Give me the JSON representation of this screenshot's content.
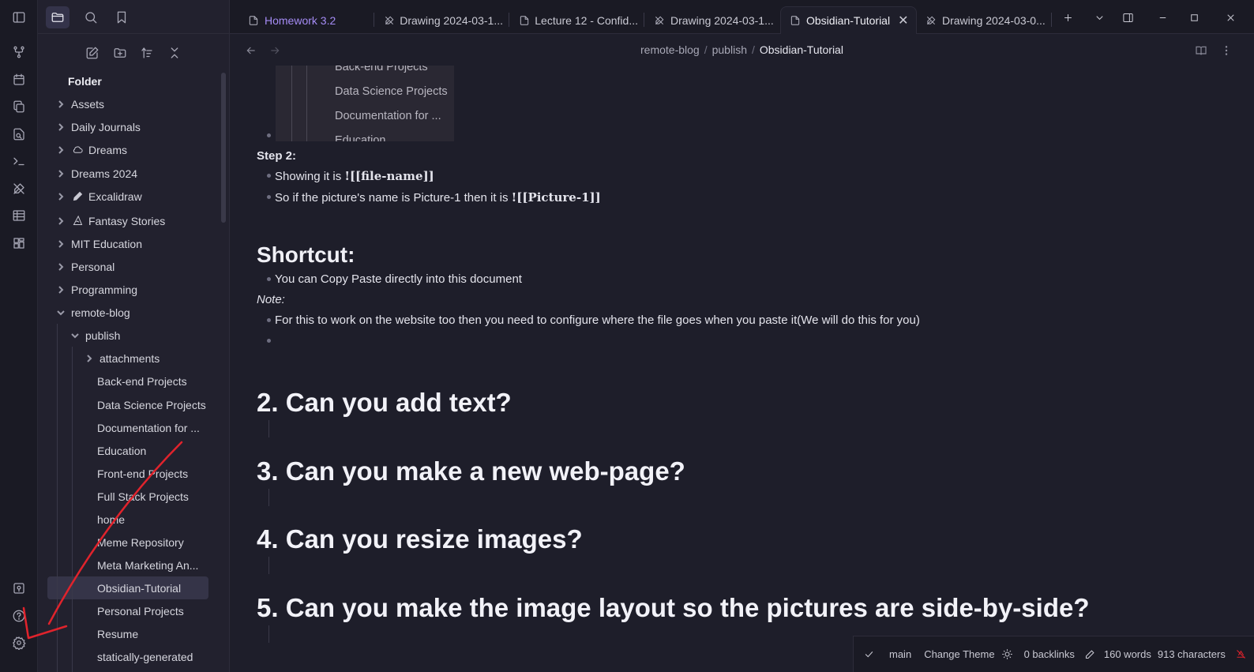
{
  "ribbon": {
    "icons": [
      "graph-icon",
      "calendar-icon",
      "copy-icon",
      "file-search-icon",
      "terminal-icon",
      "excalidraw-icon",
      "table-icon",
      "dashboard-icon"
    ],
    "bottom_icons": [
      "vault-icon",
      "help-icon",
      "settings-icon"
    ]
  },
  "sidebar": {
    "folder_label": "Folder",
    "items": [
      {
        "label": "Assets"
      },
      {
        "label": "Daily Journals"
      },
      {
        "label": "Dreams"
      },
      {
        "label": "Dreams 2024"
      },
      {
        "label": "Excalidraw"
      },
      {
        "label": "Fantasy Stories"
      },
      {
        "label": "MIT Education"
      },
      {
        "label": "Personal"
      },
      {
        "label": "Programming"
      },
      {
        "label": "remote-blog"
      },
      {
        "label": "publish"
      },
      {
        "label": "attachments"
      },
      {
        "label": "Back-end Projects"
      },
      {
        "label": "Data Science Projects"
      },
      {
        "label": "Documentation for ..."
      },
      {
        "label": "Education"
      },
      {
        "label": "Front-end Projects"
      },
      {
        "label": "Full Stack Projects"
      },
      {
        "label": "home"
      },
      {
        "label": "Meme Repository"
      },
      {
        "label": "Meta Marketing An..."
      },
      {
        "label": "Obsidian-Tutorial"
      },
      {
        "label": "Personal Projects"
      },
      {
        "label": "Resume"
      },
      {
        "label": "statically-generated"
      }
    ]
  },
  "tabs": [
    {
      "label": "Homework 3.2",
      "icon": "file-icon"
    },
    {
      "label": "Drawing 2024-03-1...",
      "icon": "excalidraw-icon"
    },
    {
      "label": "Lecture 12 - Confid...",
      "icon": "file-icon"
    },
    {
      "label": "Drawing 2024-03-1...",
      "icon": "excalidraw-icon"
    },
    {
      "label": "Obsidian-Tutorial",
      "icon": "file-icon"
    },
    {
      "label": "Drawing 2024-03-0...",
      "icon": "excalidraw-icon"
    }
  ],
  "breadcrumb": {
    "parts": [
      "remote-blog",
      "publish"
    ],
    "current": "Obsidian-Tutorial",
    "separator": "/"
  },
  "content": {
    "embed_items": [
      "Back-end Projects",
      "Data Science Projects",
      "Documentation for ...",
      "Education"
    ],
    "step2_label": "Step 2:",
    "step2_b1_text": "Showing it is ",
    "step2_b1_code": "![[file-name]]",
    "step2_b2_text": "So if the picture's name is Picture-1 then it is ",
    "step2_b2_code": "![[Picture-1]]",
    "shortcut_heading": "Shortcut:",
    "shortcut_b1": "You can Copy Paste directly into this document",
    "note_label": "Note:",
    "note_b1": "For this to work on the website too then you need to configure where the file goes when you paste it(We will do this for you)",
    "headings": [
      "2. Can you add text?",
      "3. Can you make a new web-page?",
      "4. Can you resize images?",
      "5. Can you make the image layout so the pictures are side-by-side?"
    ]
  },
  "status": {
    "branch": "main",
    "theme": "Change Theme",
    "backlinks": "0 backlinks",
    "words": "160 words",
    "characters": "913 characters"
  },
  "colors": {
    "accent_purple": "#a58cf5",
    "annotation_red": "#e0232c"
  }
}
